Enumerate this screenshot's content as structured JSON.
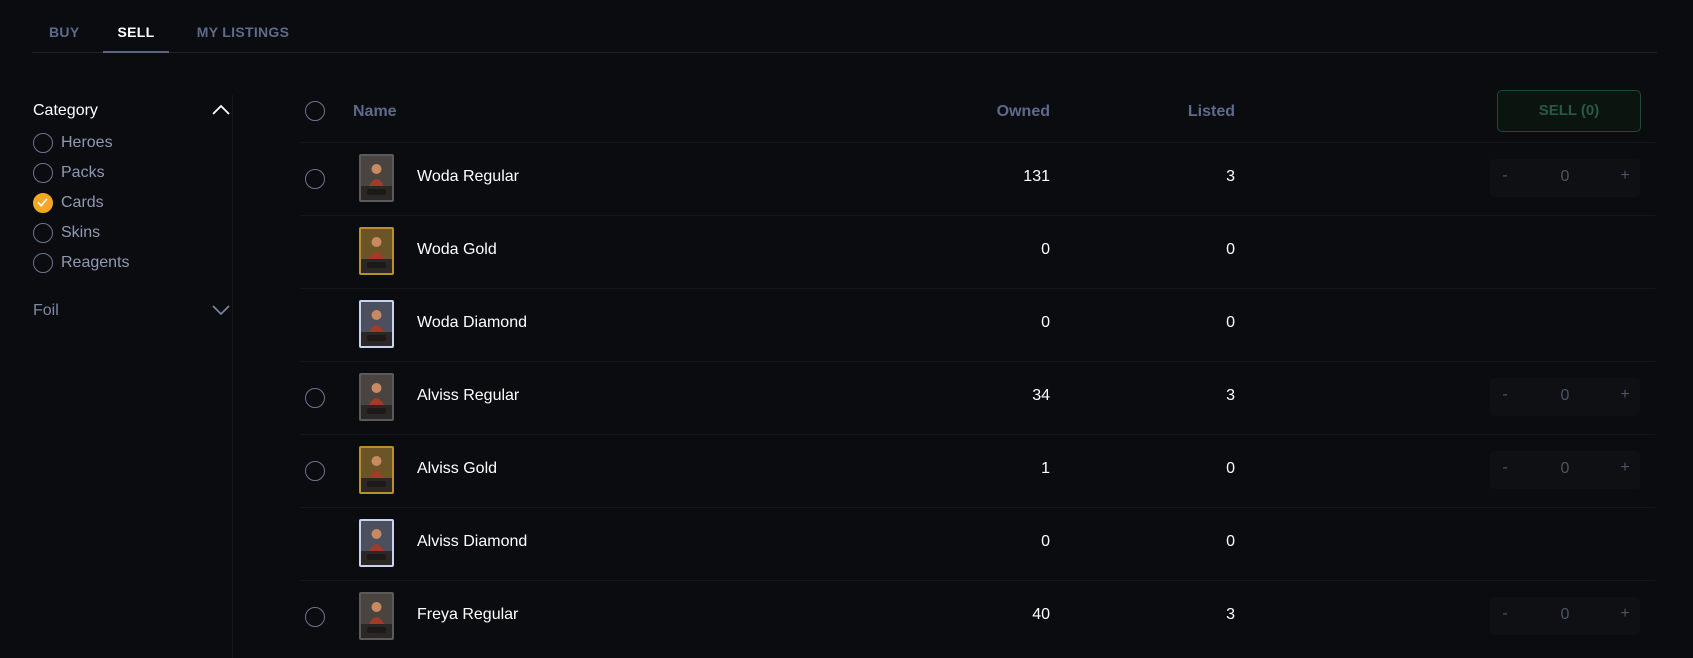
{
  "tabs": [
    {
      "label": "BUY",
      "active": false
    },
    {
      "label": "SELL",
      "active": true
    },
    {
      "label": "MY LISTINGS",
      "active": false
    }
  ],
  "sidebar": {
    "category": {
      "label": "Category",
      "expanded": true,
      "options": [
        {
          "label": "Heroes",
          "checked": false
        },
        {
          "label": "Packs",
          "checked": false
        },
        {
          "label": "Cards",
          "checked": true
        },
        {
          "label": "Skins",
          "checked": false
        },
        {
          "label": "Reagents",
          "checked": false
        }
      ]
    },
    "foil": {
      "label": "Foil",
      "expanded": false
    }
  },
  "table": {
    "headers": {
      "name": "Name",
      "owned": "Owned",
      "listed": "Listed"
    },
    "sell_button": "SELL (0)",
    "rows": [
      {
        "name": "Woda Regular",
        "owned": "131",
        "listed": "3",
        "foil": "regular",
        "selectable": true,
        "quantity": "0"
      },
      {
        "name": "Woda Gold",
        "owned": "0",
        "listed": "0",
        "foil": "gold",
        "selectable": false,
        "quantity": null
      },
      {
        "name": "Woda Diamond",
        "owned": "0",
        "listed": "0",
        "foil": "diamond",
        "selectable": false,
        "quantity": null
      },
      {
        "name": "Alviss Regular",
        "owned": "34",
        "listed": "3",
        "foil": "regular",
        "selectable": true,
        "quantity": "0"
      },
      {
        "name": "Alviss Gold",
        "owned": "1",
        "listed": "0",
        "foil": "gold",
        "selectable": true,
        "quantity": "0"
      },
      {
        "name": "Alviss Diamond",
        "owned": "0",
        "listed": "0",
        "foil": "diamond",
        "selectable": false,
        "quantity": null
      },
      {
        "name": "Freya Regular",
        "owned": "40",
        "listed": "3",
        "foil": "regular",
        "selectable": true,
        "quantity": "0"
      }
    ],
    "stepper": {
      "minus": "-",
      "plus": "+"
    }
  },
  "colors": {
    "background": "#0b0c0f",
    "accent_checked": "#f5a623",
    "sell_button_text": "#275a40",
    "muted_label": "#5d6a8c",
    "gold_frame": "#b8902a",
    "diamond_frame": "#c9d3ee"
  },
  "icons": {
    "category_toggle": "chevron-up-icon",
    "foil_toggle": "chevron-down-icon",
    "checked_option": "checkmark-icon",
    "card_thumbnail": "card-art-icon"
  }
}
